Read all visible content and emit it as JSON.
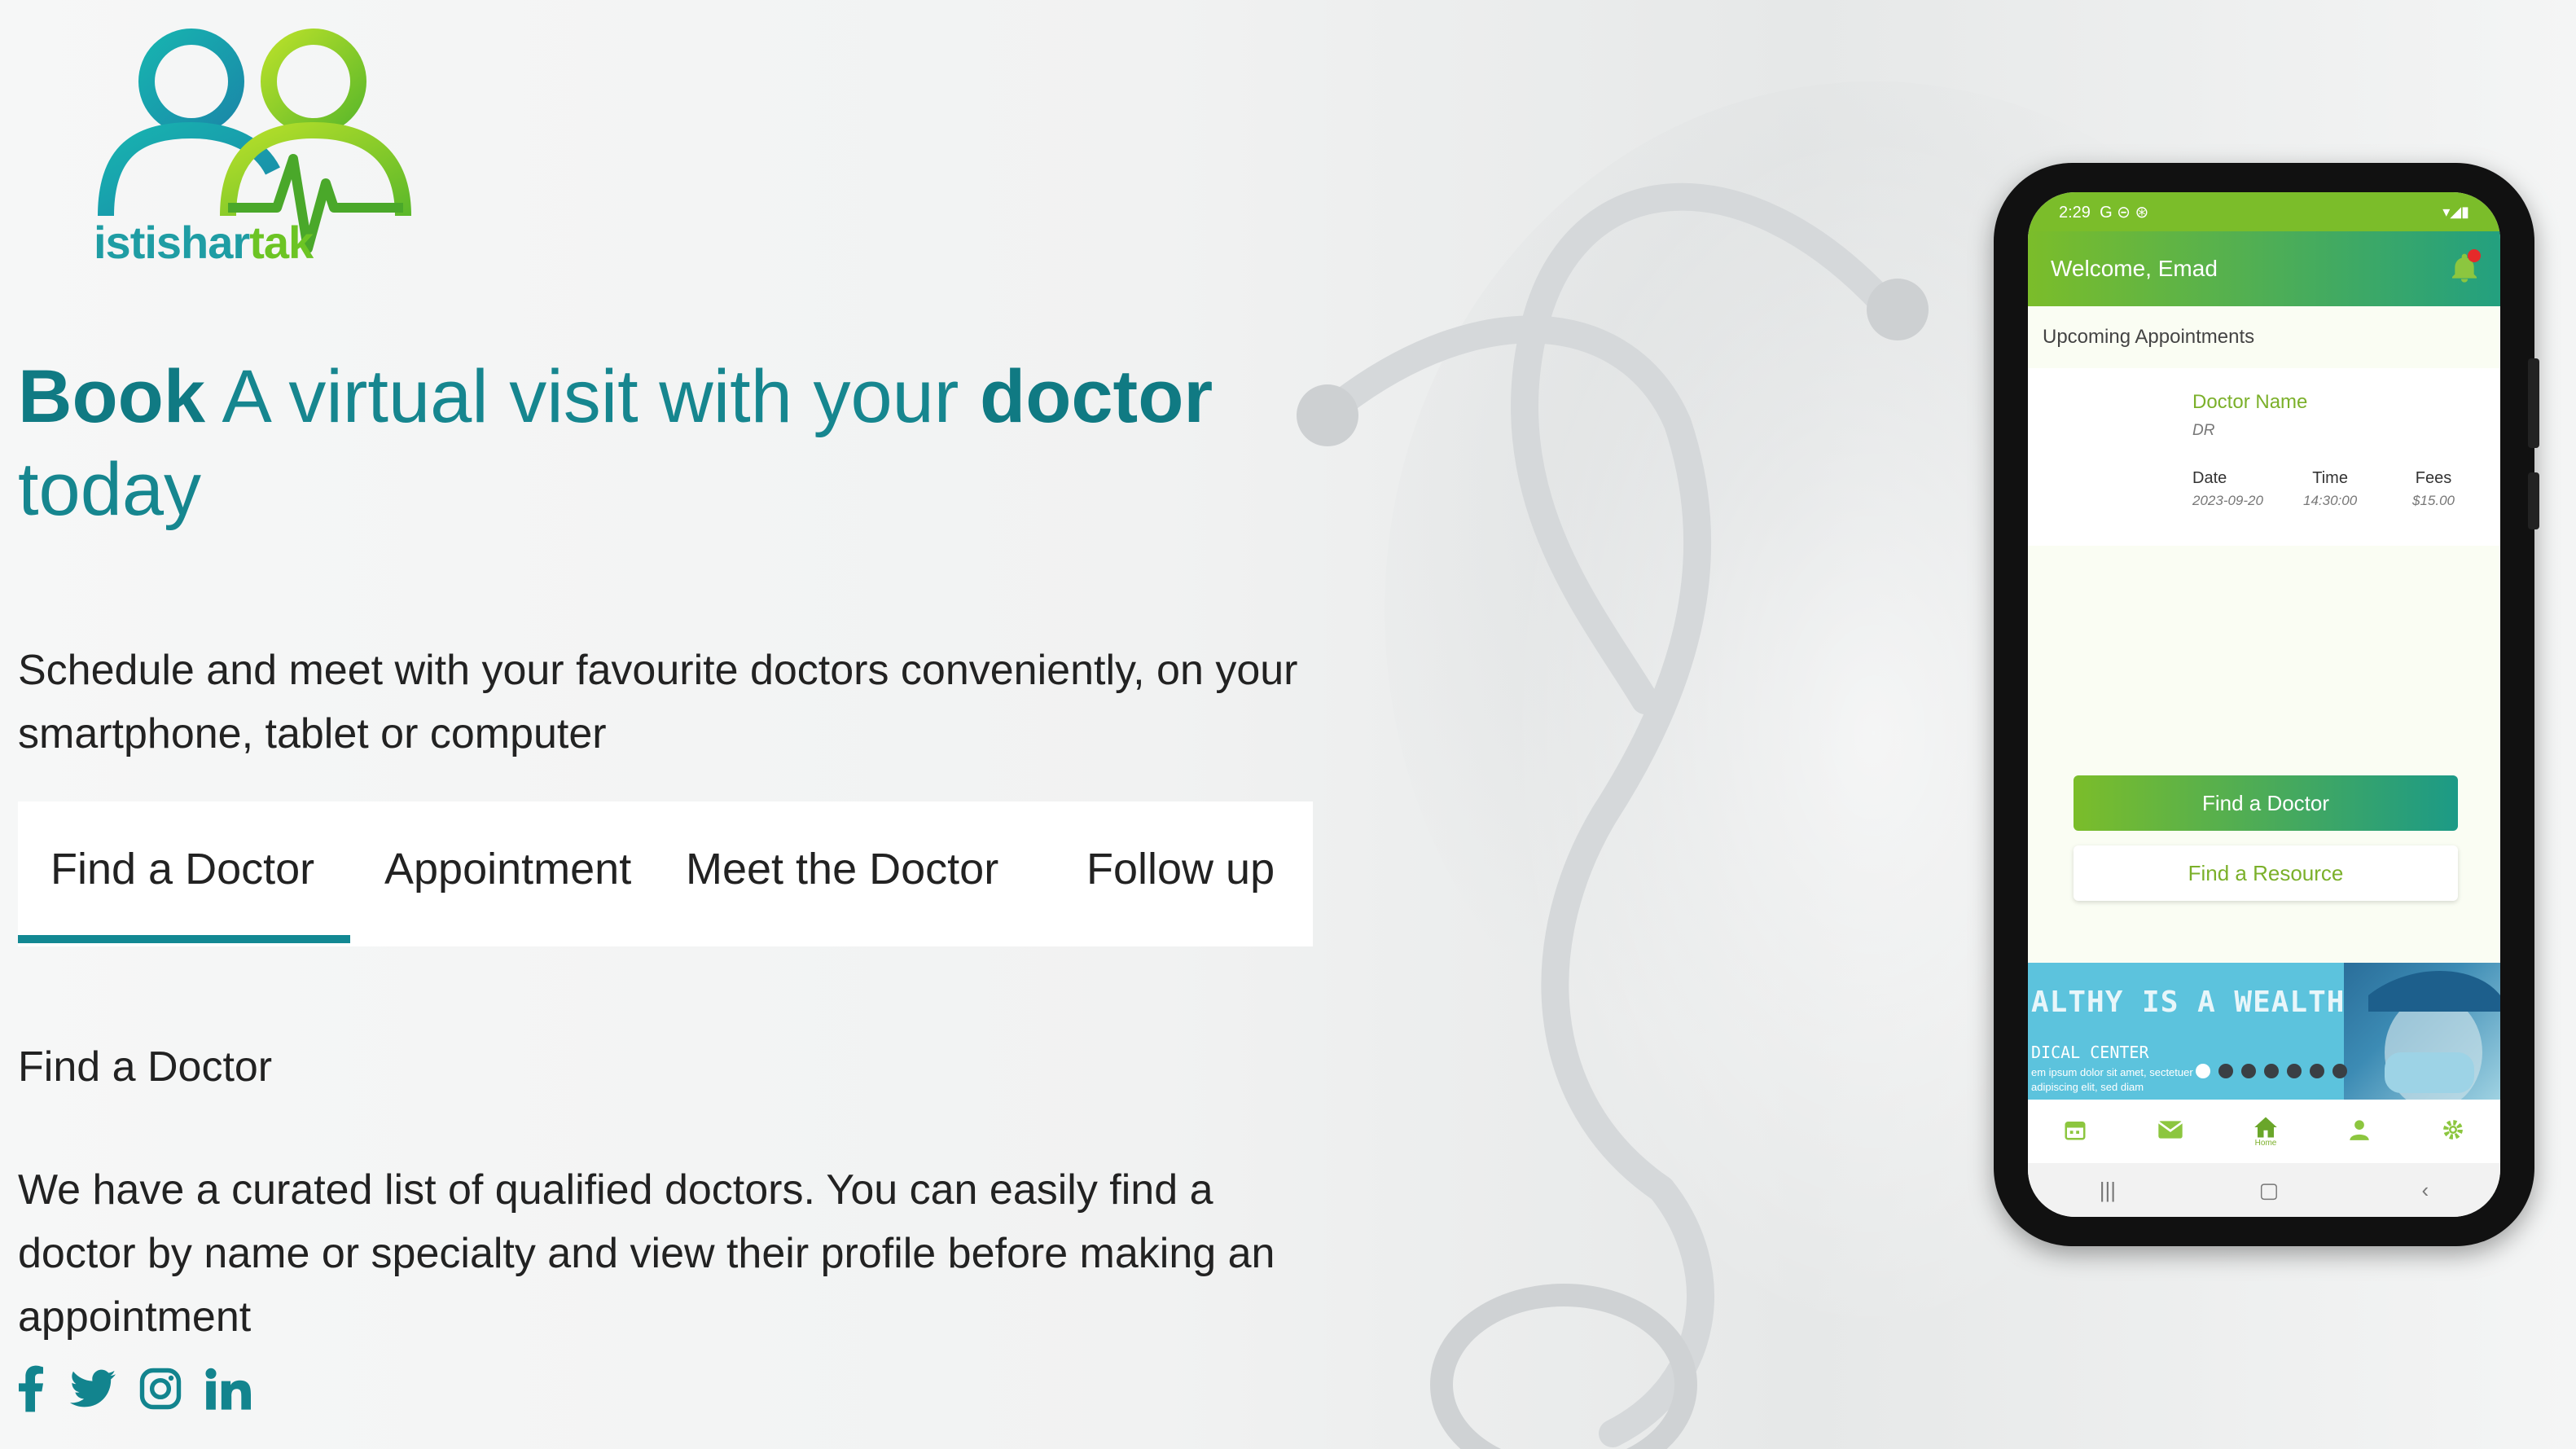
{
  "brand": {
    "name_part1": "istishar",
    "name_part2": "tak"
  },
  "hero": {
    "headline_bold1": "Book",
    "headline_mid": " A virtual visit with your ",
    "headline_bold2": "doctor",
    "headline_end": "today",
    "subtitle": "Schedule and meet with your favourite doctors conveniently, on your smartphone, tablet or computer"
  },
  "tabs": [
    {
      "label": "Find a Doctor",
      "active": true
    },
    {
      "label": "Appointment",
      "active": false
    },
    {
      "label": "Meet the Doctor",
      "active": false
    },
    {
      "label": "Follow up",
      "active": false
    }
  ],
  "section": {
    "title": "Find a Doctor",
    "body": "We have a curated list of qualified doctors. You can easily find a doctor by name or specialty and view their profile before making an appointment"
  },
  "social": [
    {
      "name": "facebook-icon"
    },
    {
      "name": "twitter-icon"
    },
    {
      "name": "instagram-icon"
    },
    {
      "name": "linkedin-icon"
    }
  ],
  "colors": {
    "teal": "#16868f",
    "green": "#7bbd2a"
  },
  "phone": {
    "status_time": "2:29",
    "status_icons": "G ⊝ ⊛",
    "welcome": "Welcome, Emad",
    "upcoming_label": "Upcoming Appointments",
    "card": {
      "doctor_name": "Doctor Name",
      "doctor_title": "DR",
      "date_label": "Date",
      "date_value": "2023-09-20",
      "time_label": "Time",
      "time_value": "14:30:00",
      "fees_label": "Fees",
      "fees_value": "$15.00"
    },
    "find_doctor_button": "Find a Doctor",
    "find_resource_button": "Find a Resource",
    "banner": {
      "title": "ALTHY IS A WEALTH",
      "subtitle": "DICAL CENTER",
      "lorem": "em ipsum dolor sit amet, sectetuer adipiscing elit, sed diam",
      "active_slide": 1,
      "slide_count": 7
    },
    "nav": {
      "home_label": "Home"
    }
  }
}
